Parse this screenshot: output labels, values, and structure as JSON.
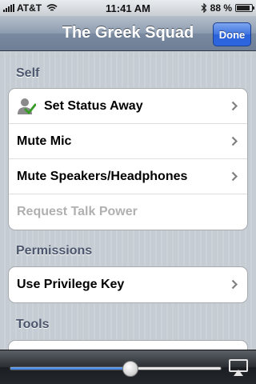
{
  "status_bar": {
    "carrier": "AT&T",
    "time": "11:41 AM",
    "battery_percent": "88 %",
    "battery_level": 0.88
  },
  "nav": {
    "title": "The Greek Squad",
    "done_label": "Done",
    "done_color": "#2c66e0"
  },
  "sections": {
    "self": {
      "header": "Self",
      "items": [
        {
          "label": "Set Status Away",
          "icon": "user-check-icon"
        },
        {
          "label": "Mute Mic"
        },
        {
          "label": "Mute Speakers/Headphones"
        },
        {
          "label": "Request Talk Power",
          "disabled": true
        }
      ]
    },
    "permissions": {
      "header": "Permissions",
      "items": [
        {
          "label": "Use Privilege Key"
        }
      ]
    },
    "tools": {
      "header": "Tools"
    }
  },
  "volume": {
    "level": 0.57,
    "fill_color": "#2c6fd6"
  }
}
